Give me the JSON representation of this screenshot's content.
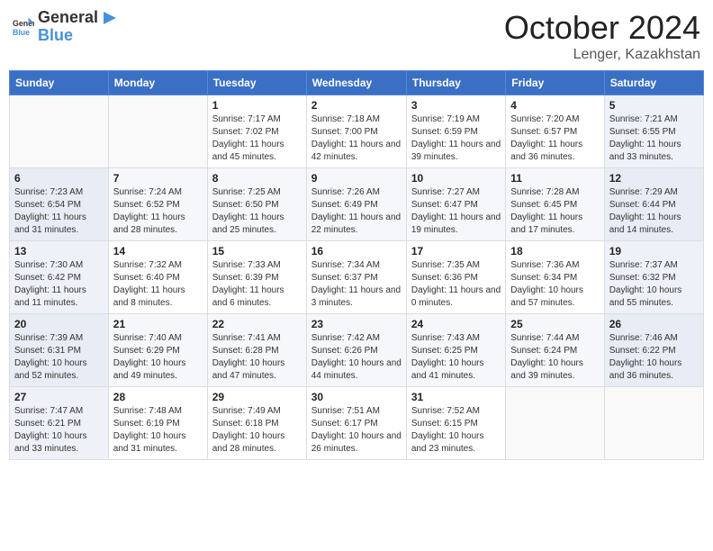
{
  "header": {
    "logo_general": "General",
    "logo_blue": "Blue",
    "month": "October 2024",
    "location": "Lenger, Kazakhstan"
  },
  "days_of_week": [
    "Sunday",
    "Monday",
    "Tuesday",
    "Wednesday",
    "Thursday",
    "Friday",
    "Saturday"
  ],
  "weeks": [
    [
      {
        "day": "",
        "sunrise": "",
        "sunset": "",
        "daylight": ""
      },
      {
        "day": "",
        "sunrise": "",
        "sunset": "",
        "daylight": ""
      },
      {
        "day": "1",
        "sunrise": "Sunrise: 7:17 AM",
        "sunset": "Sunset: 7:02 PM",
        "daylight": "Daylight: 11 hours and 45 minutes."
      },
      {
        "day": "2",
        "sunrise": "Sunrise: 7:18 AM",
        "sunset": "Sunset: 7:00 PM",
        "daylight": "Daylight: 11 hours and 42 minutes."
      },
      {
        "day": "3",
        "sunrise": "Sunrise: 7:19 AM",
        "sunset": "Sunset: 6:59 PM",
        "daylight": "Daylight: 11 hours and 39 minutes."
      },
      {
        "day": "4",
        "sunrise": "Sunrise: 7:20 AM",
        "sunset": "Sunset: 6:57 PM",
        "daylight": "Daylight: 11 hours and 36 minutes."
      },
      {
        "day": "5",
        "sunrise": "Sunrise: 7:21 AM",
        "sunset": "Sunset: 6:55 PM",
        "daylight": "Daylight: 11 hours and 33 minutes."
      }
    ],
    [
      {
        "day": "6",
        "sunrise": "Sunrise: 7:23 AM",
        "sunset": "Sunset: 6:54 PM",
        "daylight": "Daylight: 11 hours and 31 minutes."
      },
      {
        "day": "7",
        "sunrise": "Sunrise: 7:24 AM",
        "sunset": "Sunset: 6:52 PM",
        "daylight": "Daylight: 11 hours and 28 minutes."
      },
      {
        "day": "8",
        "sunrise": "Sunrise: 7:25 AM",
        "sunset": "Sunset: 6:50 PM",
        "daylight": "Daylight: 11 hours and 25 minutes."
      },
      {
        "day": "9",
        "sunrise": "Sunrise: 7:26 AM",
        "sunset": "Sunset: 6:49 PM",
        "daylight": "Daylight: 11 hours and 22 minutes."
      },
      {
        "day": "10",
        "sunrise": "Sunrise: 7:27 AM",
        "sunset": "Sunset: 6:47 PM",
        "daylight": "Daylight: 11 hours and 19 minutes."
      },
      {
        "day": "11",
        "sunrise": "Sunrise: 7:28 AM",
        "sunset": "Sunset: 6:45 PM",
        "daylight": "Daylight: 11 hours and 17 minutes."
      },
      {
        "day": "12",
        "sunrise": "Sunrise: 7:29 AM",
        "sunset": "Sunset: 6:44 PM",
        "daylight": "Daylight: 11 hours and 14 minutes."
      }
    ],
    [
      {
        "day": "13",
        "sunrise": "Sunrise: 7:30 AM",
        "sunset": "Sunset: 6:42 PM",
        "daylight": "Daylight: 11 hours and 11 minutes."
      },
      {
        "day": "14",
        "sunrise": "Sunrise: 7:32 AM",
        "sunset": "Sunset: 6:40 PM",
        "daylight": "Daylight: 11 hours and 8 minutes."
      },
      {
        "day": "15",
        "sunrise": "Sunrise: 7:33 AM",
        "sunset": "Sunset: 6:39 PM",
        "daylight": "Daylight: 11 hours and 6 minutes."
      },
      {
        "day": "16",
        "sunrise": "Sunrise: 7:34 AM",
        "sunset": "Sunset: 6:37 PM",
        "daylight": "Daylight: 11 hours and 3 minutes."
      },
      {
        "day": "17",
        "sunrise": "Sunrise: 7:35 AM",
        "sunset": "Sunset: 6:36 PM",
        "daylight": "Daylight: 11 hours and 0 minutes."
      },
      {
        "day": "18",
        "sunrise": "Sunrise: 7:36 AM",
        "sunset": "Sunset: 6:34 PM",
        "daylight": "Daylight: 10 hours and 57 minutes."
      },
      {
        "day": "19",
        "sunrise": "Sunrise: 7:37 AM",
        "sunset": "Sunset: 6:32 PM",
        "daylight": "Daylight: 10 hours and 55 minutes."
      }
    ],
    [
      {
        "day": "20",
        "sunrise": "Sunrise: 7:39 AM",
        "sunset": "Sunset: 6:31 PM",
        "daylight": "Daylight: 10 hours and 52 minutes."
      },
      {
        "day": "21",
        "sunrise": "Sunrise: 7:40 AM",
        "sunset": "Sunset: 6:29 PM",
        "daylight": "Daylight: 10 hours and 49 minutes."
      },
      {
        "day": "22",
        "sunrise": "Sunrise: 7:41 AM",
        "sunset": "Sunset: 6:28 PM",
        "daylight": "Daylight: 10 hours and 47 minutes."
      },
      {
        "day": "23",
        "sunrise": "Sunrise: 7:42 AM",
        "sunset": "Sunset: 6:26 PM",
        "daylight": "Daylight: 10 hours and 44 minutes."
      },
      {
        "day": "24",
        "sunrise": "Sunrise: 7:43 AM",
        "sunset": "Sunset: 6:25 PM",
        "daylight": "Daylight: 10 hours and 41 minutes."
      },
      {
        "day": "25",
        "sunrise": "Sunrise: 7:44 AM",
        "sunset": "Sunset: 6:24 PM",
        "daylight": "Daylight: 10 hours and 39 minutes."
      },
      {
        "day": "26",
        "sunrise": "Sunrise: 7:46 AM",
        "sunset": "Sunset: 6:22 PM",
        "daylight": "Daylight: 10 hours and 36 minutes."
      }
    ],
    [
      {
        "day": "27",
        "sunrise": "Sunrise: 7:47 AM",
        "sunset": "Sunset: 6:21 PM",
        "daylight": "Daylight: 10 hours and 33 minutes."
      },
      {
        "day": "28",
        "sunrise": "Sunrise: 7:48 AM",
        "sunset": "Sunset: 6:19 PM",
        "daylight": "Daylight: 10 hours and 31 minutes."
      },
      {
        "day": "29",
        "sunrise": "Sunrise: 7:49 AM",
        "sunset": "Sunset: 6:18 PM",
        "daylight": "Daylight: 10 hours and 28 minutes."
      },
      {
        "day": "30",
        "sunrise": "Sunrise: 7:51 AM",
        "sunset": "Sunset: 6:17 PM",
        "daylight": "Daylight: 10 hours and 26 minutes."
      },
      {
        "day": "31",
        "sunrise": "Sunrise: 7:52 AM",
        "sunset": "Sunset: 6:15 PM",
        "daylight": "Daylight: 10 hours and 23 minutes."
      },
      {
        "day": "",
        "sunrise": "",
        "sunset": "",
        "daylight": ""
      },
      {
        "day": "",
        "sunrise": "",
        "sunset": "",
        "daylight": ""
      }
    ]
  ]
}
